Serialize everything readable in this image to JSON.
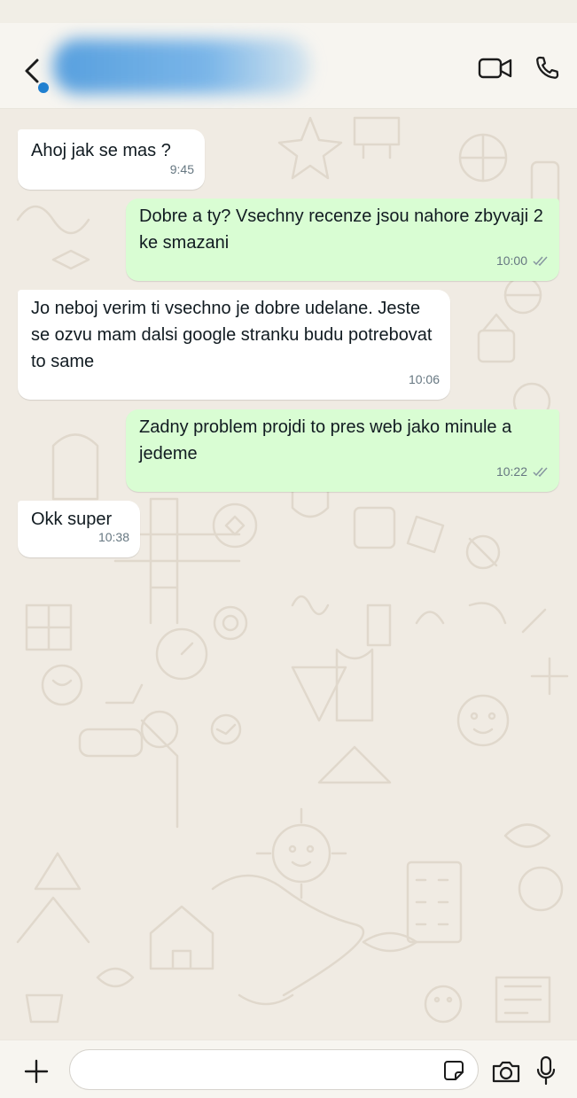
{
  "header": {
    "contact_name_redacted": true,
    "icons": {
      "back": "chevron-left-icon",
      "video": "video-camera-icon",
      "call": "phone-icon"
    }
  },
  "messages": [
    {
      "direction": "incoming",
      "text": "Ahoj jak se mas ?",
      "time": "9:45"
    },
    {
      "direction": "outgoing",
      "text": "Dobre a ty? Vsechny recenze jsou nahore zbyvaji 2 ke smazani",
      "time": "10:00",
      "status": "read"
    },
    {
      "direction": "incoming",
      "text": "Jo neboj verim ti vsechno je dobre udelane. Jeste se ozvu mam dalsi google stranku budu potrebovat to same",
      "time": "10:06"
    },
    {
      "direction": "outgoing",
      "text": "Zadny problem projdi to pres web jako minule a jedeme",
      "time": "10:22",
      "status": "read"
    },
    {
      "direction": "incoming",
      "text": "Okk super",
      "time": "10:38"
    }
  ],
  "composer": {
    "placeholder": "",
    "icons": {
      "attach": "plus-icon",
      "sticker": "sticker-icon",
      "camera": "camera-icon",
      "mic": "microphone-icon"
    }
  },
  "colors": {
    "incoming_bubble": "#ffffff",
    "outgoing_bubble": "#d9fdd3",
    "chat_background": "#f0ebe3",
    "timestamp": "#667781",
    "read_ticks": "#8696a0"
  }
}
